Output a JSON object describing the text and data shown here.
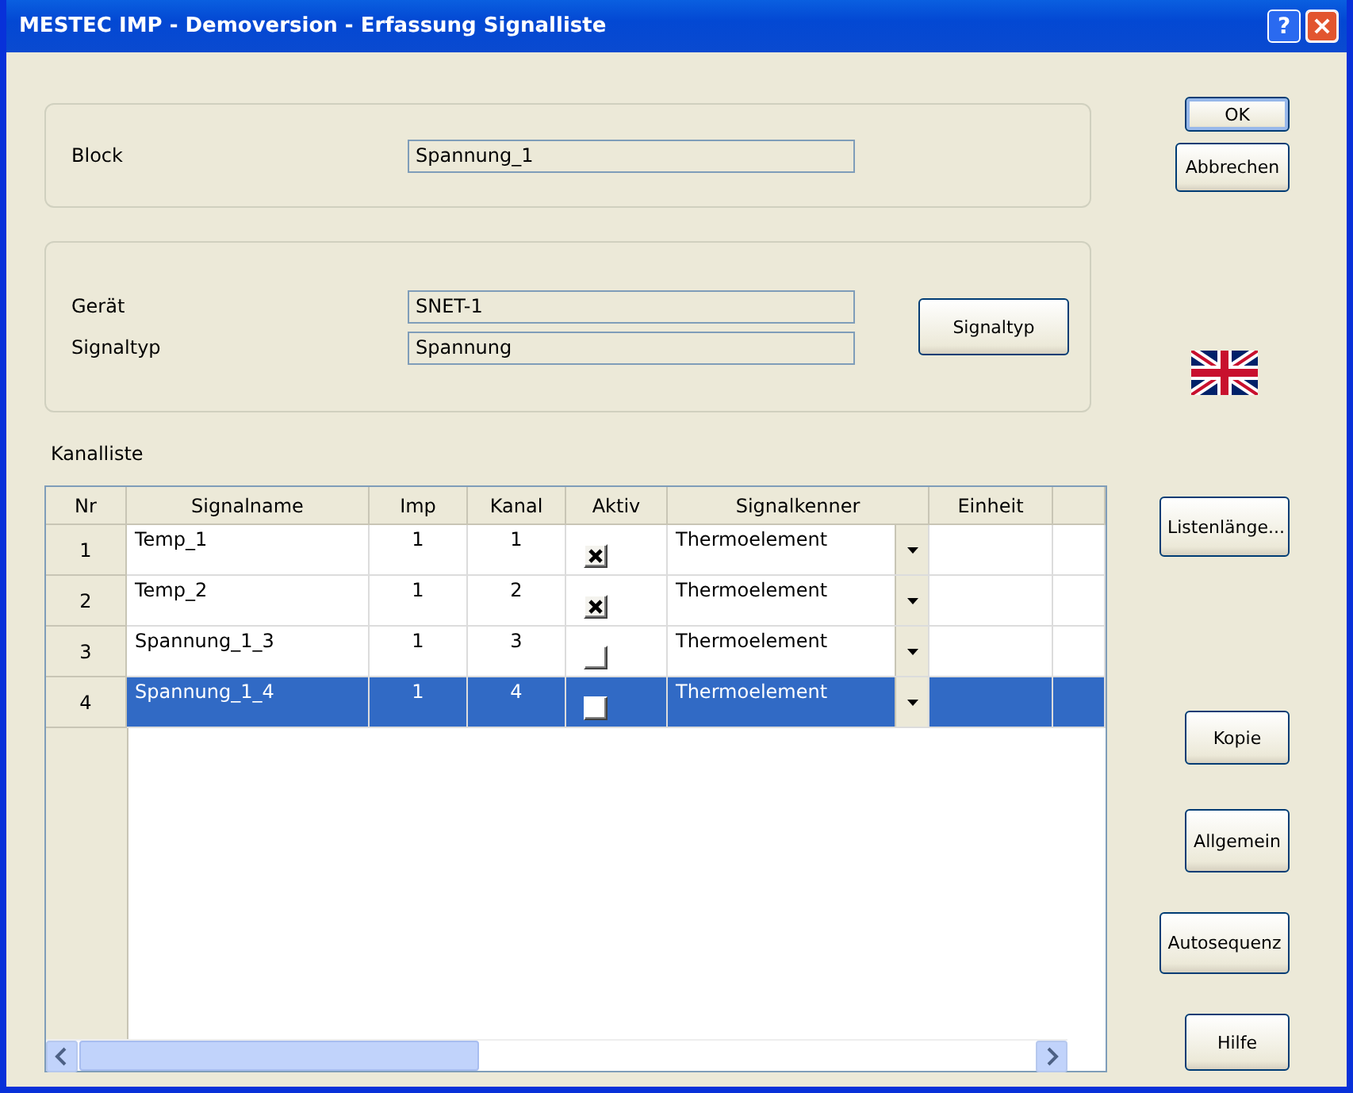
{
  "window": {
    "title": "MESTEC IMP - Demoversion - Erfassung Signalliste",
    "help_button": "?"
  },
  "block": {
    "label": "Block",
    "value": "Spannung_1"
  },
  "device": {
    "fields": [
      {
        "label": "Gerät",
        "value": "SNET-1"
      },
      {
        "label": "Signaltyp",
        "value": "Spannung"
      }
    ],
    "button": "Signaltyp"
  },
  "channel_list": {
    "label": "Kanalliste",
    "columns": [
      "Nr",
      "Signalname",
      "Imp",
      "Kanal",
      "Aktiv",
      "Signalkenner",
      "Einheit"
    ],
    "rows": [
      {
        "nr": "1",
        "signalname": "Temp_1",
        "imp": "1",
        "kanal": "1",
        "aktiv": true,
        "signalkenner": "Thermoelement",
        "selected": false
      },
      {
        "nr": "2",
        "signalname": "Temp_2",
        "imp": "1",
        "kanal": "2",
        "aktiv": true,
        "signalkenner": "Thermoelement",
        "selected": false
      },
      {
        "nr": "3",
        "signalname": "Spannung_1_3",
        "imp": "1",
        "kanal": "3",
        "aktiv": false,
        "signalkenner": "Thermoelement",
        "selected": false
      },
      {
        "nr": "4",
        "signalname": "Spannung_1_4",
        "imp": "1",
        "kanal": "4",
        "aktiv": false,
        "signalkenner": "Thermoelement",
        "selected": true
      }
    ]
  },
  "side_buttons": [
    {
      "label": "OK",
      "default": true
    },
    {
      "label": "Abbrechen",
      "default": false
    },
    {
      "label": "Listenlänge...",
      "default": false
    },
    {
      "label": "Kopie",
      "default": false
    },
    {
      "label": "Allgemein",
      "default": false
    },
    {
      "label": "Autosequenz",
      "default": false
    },
    {
      "label": "Hilfe",
      "default": false
    }
  ]
}
